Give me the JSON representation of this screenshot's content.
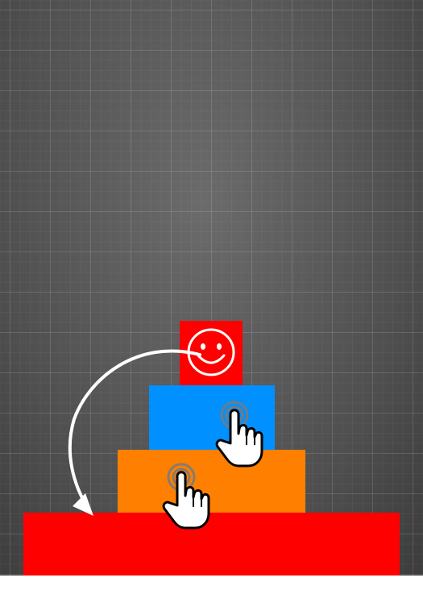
{
  "scene": {
    "background_color": "#5a5a5a",
    "grid_color": "#7a7a7a"
  },
  "blocks": [
    {
      "name": "base-block",
      "color": "#ff0000"
    },
    {
      "name": "orange-block",
      "color": "#ff8000"
    },
    {
      "name": "blue-block",
      "color": "#0090ff"
    },
    {
      "name": "smiley-block",
      "color": "#ff0000",
      "icon": "smiley-face-icon"
    }
  ],
  "hints": {
    "tap_icon": "tap-hand-icon",
    "drag_arrow": "curved-arrow-icon"
  }
}
